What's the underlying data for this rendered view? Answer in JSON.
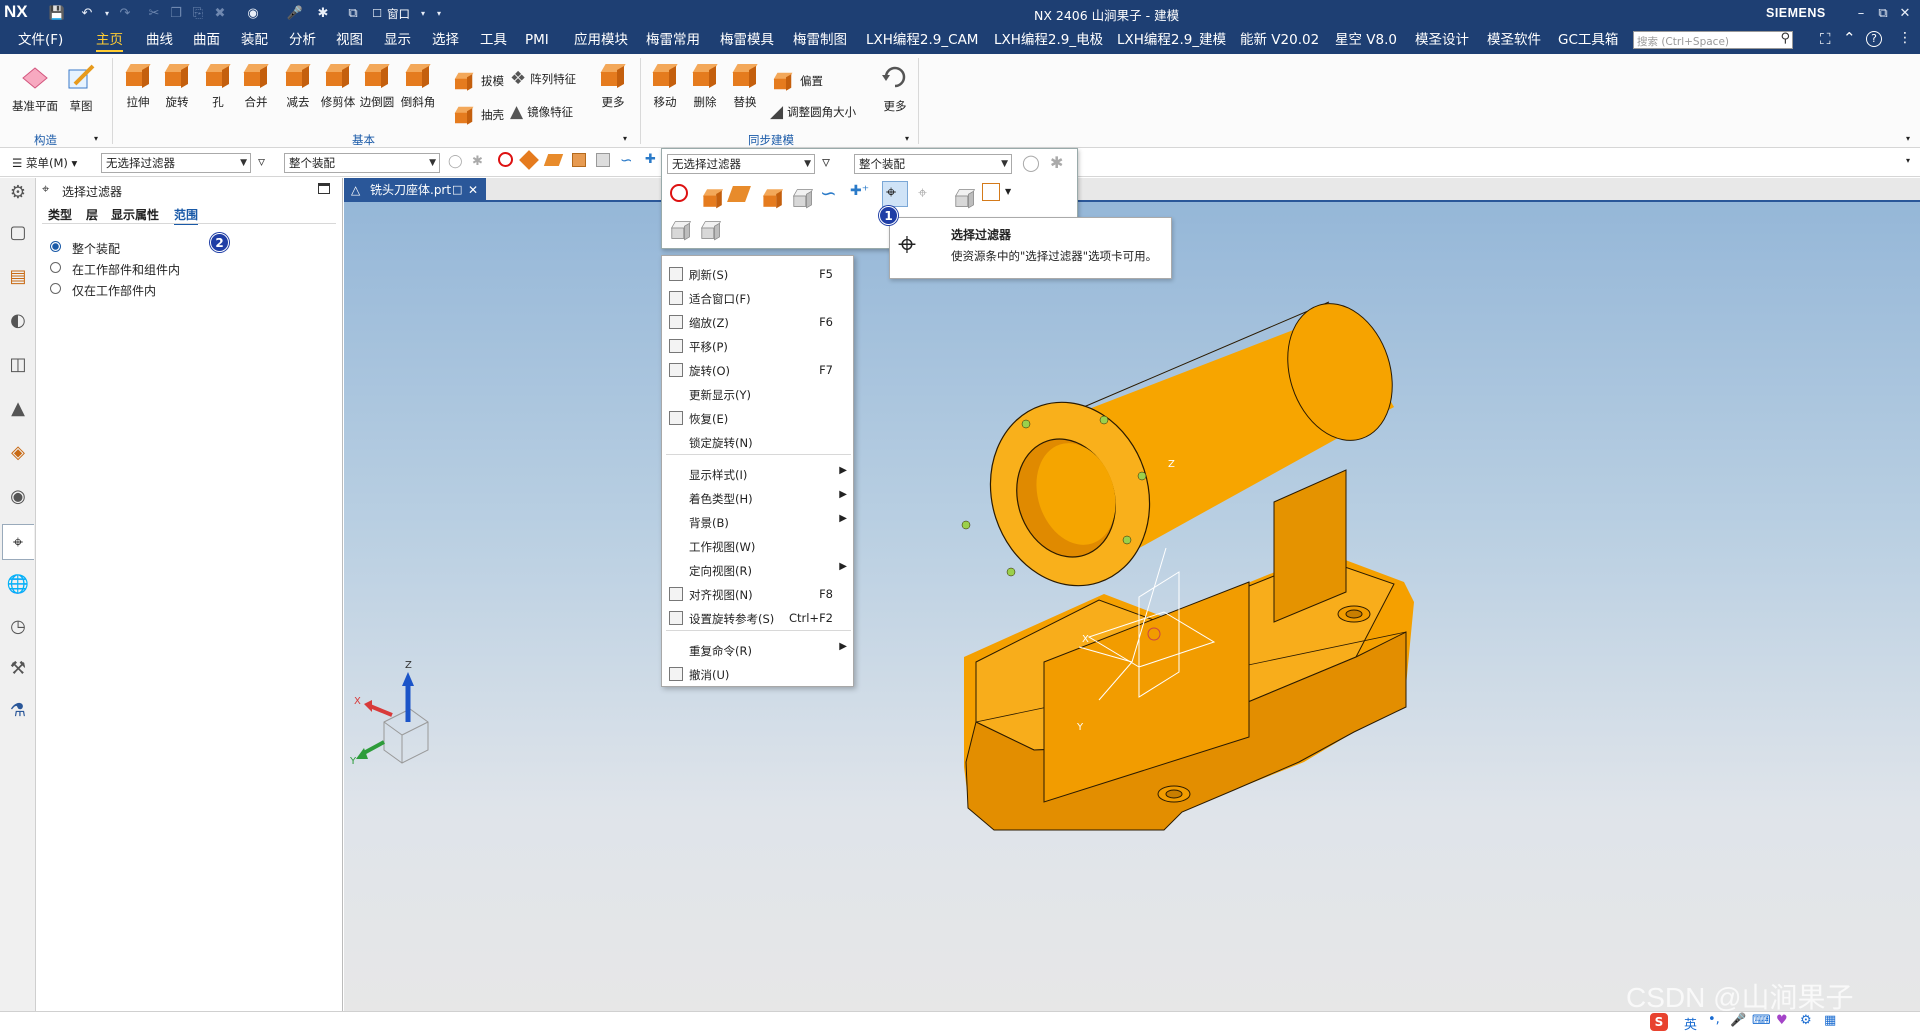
{
  "app": {
    "logo": "NX",
    "title": "NX 2406 山涧果子 - 建模",
    "brand": "SIEMENS",
    "window_label": "窗口"
  },
  "menubar": {
    "items": [
      "文件(F)",
      "主页",
      "曲线",
      "曲面",
      "装配",
      "分析",
      "视图",
      "显示",
      "选择",
      "工具",
      "PMI",
      "应用模块",
      "梅雷常用",
      "梅雷模具",
      "梅雷制图",
      "LXH编程2.9_CAM",
      "LXH编程2.9_电极",
      "LXH编程2.9_建模",
      "能新 V20.02",
      "星空 V8.0",
      "模圣设计",
      "模圣软件",
      "GC工具箱"
    ],
    "active": "主页",
    "search_placeholder": "搜索 (Ctrl+Space)"
  },
  "ribbon": {
    "construct": {
      "items": [
        "基准平面",
        "草图"
      ],
      "label": "构造"
    },
    "basic": {
      "items": [
        "拉伸",
        "旋转",
        "孔",
        "合并",
        "减去",
        "修剪体",
        "边倒圆",
        "倒斜角"
      ],
      "small": [
        "拔模",
        "抽壳",
        "阵列特征",
        "镜像特征"
      ],
      "more": "更多",
      "label": "基本"
    },
    "sync": {
      "items": [
        "移动",
        "删除",
        "替换"
      ],
      "small": [
        "偏置",
        "调整圆角大小"
      ],
      "more": "更多",
      "label": "同步建模"
    }
  },
  "selbar": {
    "menu_label": "菜单(M)",
    "filter_value": "无选择过滤器",
    "scope_value": "整个装配"
  },
  "navpanel": {
    "title": "选择过滤器",
    "tabs": [
      "类型",
      "层",
      "显示属性",
      "范围"
    ],
    "active_tab": "范围",
    "options": [
      "整个装配",
      "在工作部件和组件内",
      "仅在工作部件内"
    ],
    "selected_option": "整个装配"
  },
  "doc_tab": {
    "label": "铣头刀座体.prt"
  },
  "popup": {
    "filter_value": "无选择过滤器",
    "scope_value": "整个装配"
  },
  "context_menu": {
    "items": [
      {
        "label": "刷新(S)",
        "shortcut": "F5"
      },
      {
        "label": "适合窗口(F)",
        "shortcut": ""
      },
      {
        "label": "缩放(Z)",
        "shortcut": "F6"
      },
      {
        "label": "平移(P)",
        "shortcut": ""
      },
      {
        "label": "旋转(O)",
        "shortcut": "F7"
      },
      {
        "label": "更新显示(Y)",
        "shortcut": ""
      },
      {
        "label": "恢复(E)",
        "shortcut": ""
      },
      {
        "label": "锁定旋转(N)",
        "shortcut": ""
      },
      {
        "label": "显示样式(I)",
        "shortcut": ""
      },
      {
        "label": "着色类型(H)",
        "shortcut": ""
      },
      {
        "label": "背景(B)",
        "shortcut": ""
      },
      {
        "label": "工作视图(W)",
        "shortcut": ""
      },
      {
        "label": "定向视图(R)",
        "shortcut": ""
      },
      {
        "label": "对齐视图(N)",
        "shortcut": "F8"
      },
      {
        "label": "设置旋转参考(S)",
        "shortcut": "Ctrl+F2"
      },
      {
        "label": "重复命令(R)",
        "shortcut": ""
      },
      {
        "label": "撤消(U)",
        "shortcut": ""
      }
    ]
  },
  "tooltip": {
    "title": "选择过滤器",
    "description": "使资源条中的\"选择过滤器\"选项卡可用。"
  },
  "badges": [
    "1",
    "2"
  ],
  "triad_labels": {
    "x": "X",
    "y": "Y",
    "z": "Z"
  },
  "watermark": "CSDN @山涧果子",
  "ime": {
    "lang": "英"
  },
  "colors": {
    "titlebar": "#1e3f73",
    "active_tab": "#ffcc33",
    "part": "#f5a000",
    "doc_tab": "#2a5799"
  }
}
